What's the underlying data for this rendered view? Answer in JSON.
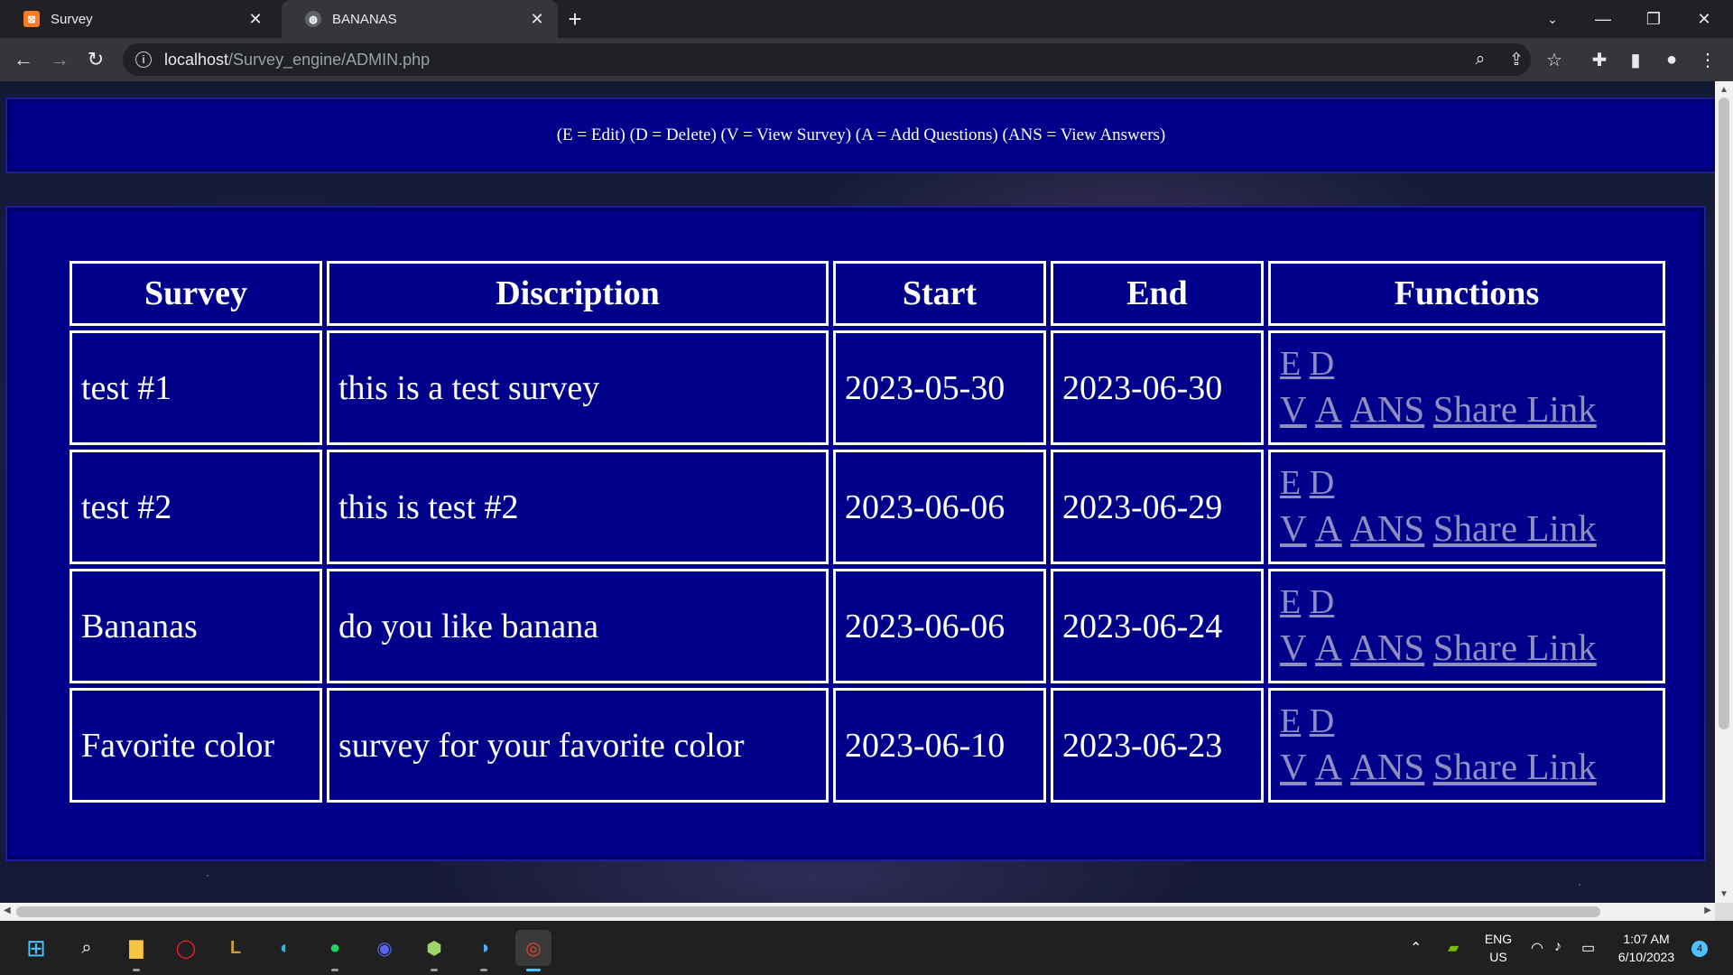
{
  "browser": {
    "tabs": [
      {
        "title": "Survey",
        "active": false,
        "favicon": "xampp-icon"
      },
      {
        "title": "BANANAS",
        "active": true,
        "favicon": "globe-icon"
      }
    ],
    "new_tab_symbol": "+",
    "url_host": "localhost",
    "url_path": "/Survey_engine/ADMIN.php"
  },
  "page": {
    "legend": "(E = Edit) (D = Delete) (V = View Survey) (A = Add Questions) (ANS = View Answers)",
    "table": {
      "headers": [
        "Survey",
        "Discription",
        "Start",
        "End",
        "Functions"
      ],
      "rows": [
        {
          "survey": "test #1",
          "description": "this is a test survey",
          "start": "2023-05-30",
          "end": "2023-06-30"
        },
        {
          "survey": "test #2",
          "description": "this is test #2",
          "start": "2023-06-06",
          "end": "2023-06-29"
        },
        {
          "survey": "Bananas",
          "description": "do you like banana",
          "start": "2023-06-06",
          "end": "2023-06-24"
        },
        {
          "survey": "Favorite color",
          "description": "survey for your favorite color",
          "start": "2023-06-10",
          "end": "2023-06-23"
        }
      ],
      "function_links": {
        "edit": "E",
        "delete": "D",
        "view": "V",
        "add": "A",
        "answers": "ANS",
        "share": "Share Link"
      }
    },
    "colors": {
      "panel": "#00008b",
      "link": "#8e8ec0",
      "text": "#ffffff"
    }
  },
  "taskbar": {
    "apps": [
      "windows-start-icon",
      "search-icon",
      "file-explorer-icon",
      "opera-icon",
      "league-of-legends-icon",
      "edge-icon",
      "spotify-icon",
      "discord-icon",
      "app-icon",
      "virtualbox-icon",
      "chrome-icon"
    ],
    "language": "ENG",
    "region": "US",
    "time": "1:07 AM",
    "date": "6/10/2023",
    "notifications": "4"
  }
}
